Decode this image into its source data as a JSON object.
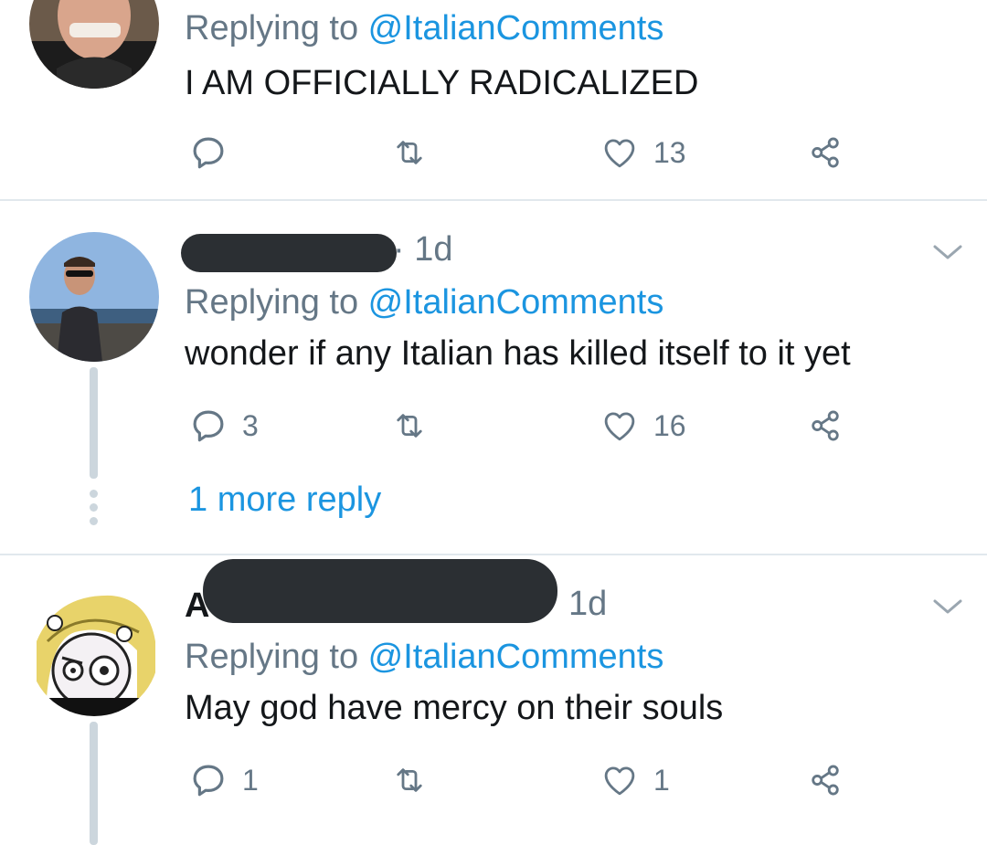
{
  "tweets": [
    {
      "replying_prefix": "Replying to ",
      "replying_handle": "@ItalianComments",
      "text": "I AM OFFICIALLY RADICALIZED",
      "actions": {
        "reply_count": "",
        "retweet_count": "",
        "like_count": "13"
      }
    },
    {
      "time": "· 1d",
      "replying_prefix": "Replying to ",
      "replying_handle": "@ItalianComments",
      "text": "wonder if any Italian has killed itself to it yet",
      "actions": {
        "reply_count": "3",
        "retweet_count": "",
        "like_count": "16"
      },
      "more_replies": "1 more reply"
    },
    {
      "name_initial": "A",
      "time": "1d",
      "replying_prefix": "Replying to ",
      "replying_handle": "@ItalianComments",
      "text": "May god have mercy on their souls",
      "actions": {
        "reply_count": "1",
        "retweet_count": "",
        "like_count": "1"
      }
    }
  ],
  "icons": {
    "reply": "reply-icon",
    "retweet": "retweet-icon",
    "like": "heart-icon",
    "share": "share-icon",
    "caret": "chevron-down-icon"
  },
  "colors": {
    "link": "#1b95e0",
    "secondary_text": "#657786",
    "divider": "#e1e8ed",
    "thread_line": "#ccd6dd",
    "redaction": "#2b2f33"
  }
}
